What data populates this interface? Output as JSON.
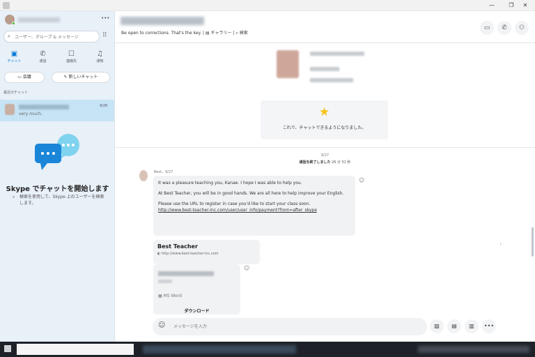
{
  "window": {
    "minimize": "—",
    "maximize": "❐",
    "close": "✕"
  },
  "sidebar": {
    "more": "•••",
    "search_placeholder": "ユーザー、グループ & メッセージ",
    "tabs": [
      {
        "label": "チャット",
        "icon": "chat-icon"
      },
      {
        "label": "通話",
        "icon": "phone-icon"
      },
      {
        "label": "連絡先",
        "icon": "contacts-icon"
      },
      {
        "label": "通知",
        "icon": "bell-icon"
      }
    ],
    "meeting_label": "会議",
    "new_chat_label": "新しいチャット",
    "section_label": "最近のチャット",
    "recent_chat": {
      "time": "9/28",
      "preview": "very much."
    },
    "empty_title": "Skype でチャットを開始します",
    "empty_desc": "検索を使用して、Skype 上のユーザーを検索します。"
  },
  "header": {
    "mood": "Be open to corrections. That's the key.",
    "gallery": "ギャラリー",
    "find": "検索"
  },
  "conversation": {
    "info_text": "これで、チャットできるようになりました。",
    "date": "9/27",
    "call_ended": "通話を終了しました",
    "call_duration": "26 分 51 秒",
    "sender_meta": "Best，9/27",
    "message": {
      "p1": "It was a pleasure teaching you, Kanae. I hope I was able to help you.",
      "p2": "At Best Teacher, you will be in good hands. We are all here to help improve your English.",
      "p3": "Please use the URL to register in case you'd like to start your class soon.",
      "url": "http://www.best-teacher-inc.com/user/user_info/payment?from=after_skype"
    },
    "link_card": {
      "title": "Best Teacher",
      "url": "http://www.best-teacher-inc.com"
    },
    "file_card": {
      "type": "MS Word",
      "download": "ダウンロード"
    }
  },
  "composer": {
    "placeholder": "メッセージを入力"
  }
}
